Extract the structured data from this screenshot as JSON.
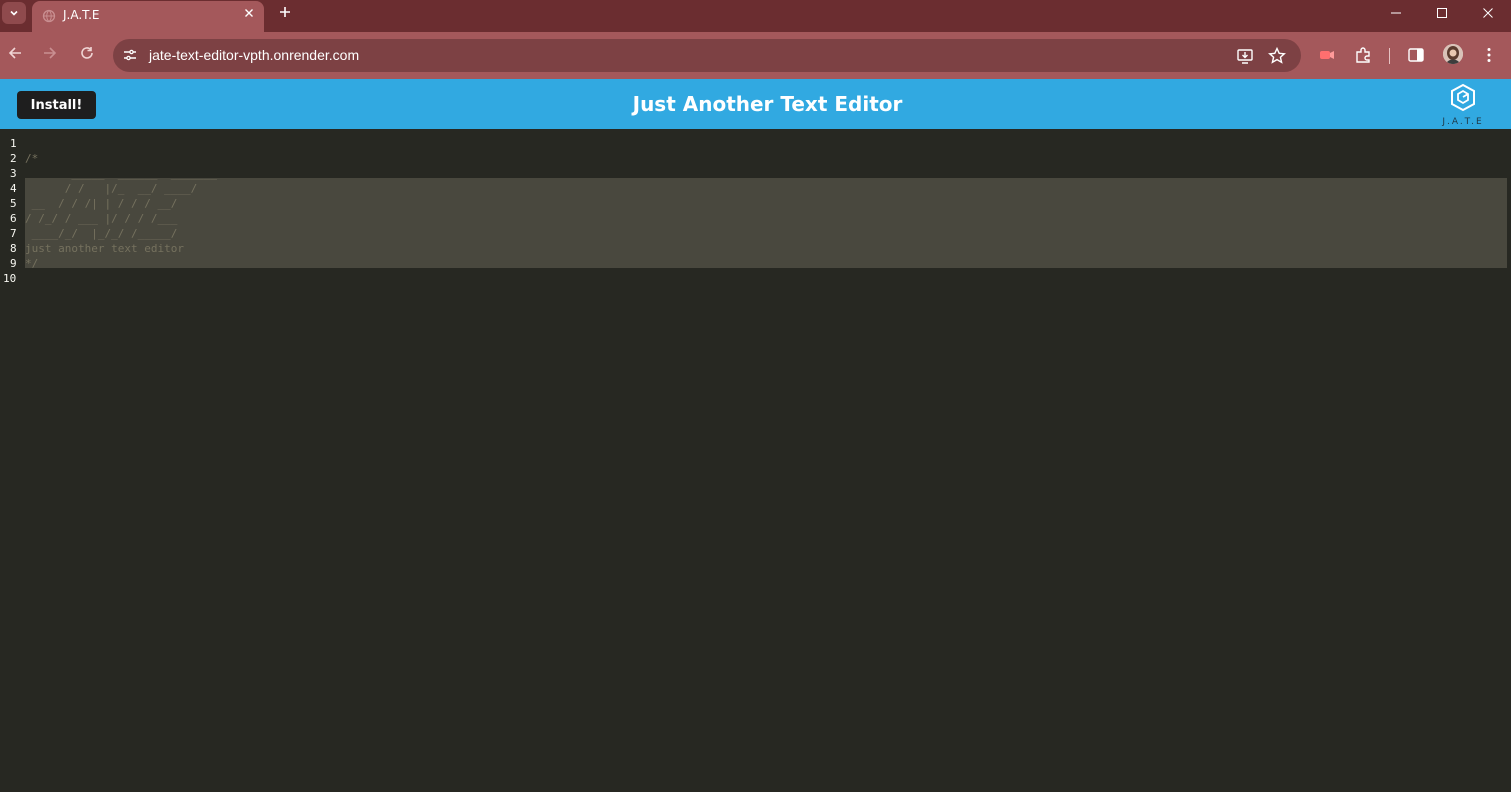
{
  "browser": {
    "tab_title": "J.A.T.E",
    "url": "jate-text-editor-vpth.onrender.com",
    "icons": {
      "tab_search": "chevron-down-icon",
      "tab_close": "close-icon",
      "new_tab": "plus-icon",
      "minimize": "minimize-icon",
      "maximize": "maximize-icon",
      "close_window": "close-icon",
      "back": "arrow-left-icon",
      "forward": "arrow-right-icon",
      "reload": "reload-icon",
      "site_info": "tune-icon",
      "install_app": "install-app-icon",
      "bookmark": "star-icon",
      "extension": "extension-icon",
      "puzzle": "puzzle-icon",
      "side_panel": "side-panel-icon",
      "menu": "kebab-menu-icon"
    }
  },
  "app": {
    "install_label": "Install!",
    "title": "Just Another Text Editor",
    "logo_text": "J.A.T.E"
  },
  "editor": {
    "line_numbers": [
      "1",
      "2",
      "3",
      "4",
      "5",
      "6",
      "7",
      "8",
      "9",
      "10"
    ],
    "lines": [
      "",
      "/*",
      "       _____  ______  _______",
      "      / /   |/_  __/ ____/",
      " __  / / /| | / / / __/",
      "/ /_/ / ___ |/ / / /___",
      " ____/_/  |_/_/ /_____/",
      "just another text editor",
      "*/",
      ""
    ],
    "selected_lines": "4-9"
  },
  "colors": {
    "tabstrip": "#6b2d30",
    "toolbar": "#a4585b",
    "header": "#31a9e1",
    "editor_bg": "#272822",
    "selection": "#49483e",
    "comment": "#75715e"
  }
}
